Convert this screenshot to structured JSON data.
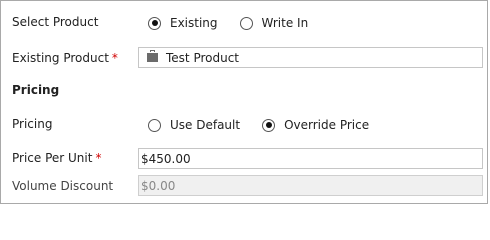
{
  "select_product": {
    "label": "Select Product",
    "options": [
      {
        "label": "Existing",
        "checked": true
      },
      {
        "label": "Write In",
        "checked": false
      }
    ]
  },
  "existing_product": {
    "label": "Existing Product",
    "required_mark": "*",
    "value": "Test Product",
    "icon": "product-icon"
  },
  "section_title": "Pricing",
  "pricing": {
    "label": "Pricing",
    "options": [
      {
        "label": "Use Default",
        "checked": false
      },
      {
        "label": "Override Price",
        "checked": true
      }
    ]
  },
  "price_per_unit": {
    "label": "Price Per Unit",
    "required_mark": "*",
    "value": "$450.00"
  },
  "volume_discount": {
    "label": "Volume Discount",
    "value": "$0.00"
  }
}
